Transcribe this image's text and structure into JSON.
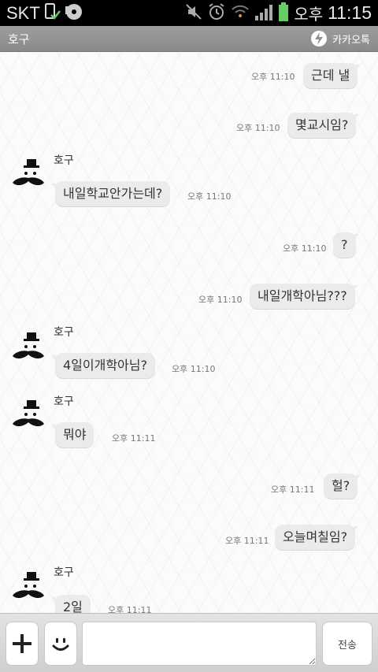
{
  "status_bar": {
    "carrier": "SKT",
    "time_label": "오후",
    "time": "11:15"
  },
  "header": {
    "room_name": "호구",
    "brand": "카카오톡"
  },
  "messages": [
    {
      "side": "out",
      "text": "근데 낼",
      "time": "오후 11:10"
    },
    {
      "side": "out",
      "text": "몇교시임?",
      "time": "오후 11:10"
    },
    {
      "side": "in",
      "sender": "호구",
      "text": "내일학교안가는데?",
      "time": "오후 11:10"
    },
    {
      "side": "out",
      "text": "?",
      "time": "오후 11:10"
    },
    {
      "side": "out",
      "text": "내일개학아님???",
      "time": "오후 11:10"
    },
    {
      "side": "in",
      "sender": "호구",
      "text": "4일이개학아님?",
      "time": "오후 11:10"
    },
    {
      "side": "in",
      "sender": "호구",
      "text": "뭐야",
      "time": "오후 11:11"
    },
    {
      "side": "out",
      "text": "헐?",
      "time": "오후 11:11"
    },
    {
      "side": "out",
      "text": "오늘며칠임?",
      "time": "오후 11:11"
    },
    {
      "side": "in",
      "sender": "호구",
      "text": "2일",
      "time": "오후 11:11"
    }
  ],
  "input_bar": {
    "message_value": "",
    "send_label": "전송"
  },
  "colors": {
    "bubble": "#ebebeb",
    "header": "#929292",
    "statusbar": "#000000"
  }
}
